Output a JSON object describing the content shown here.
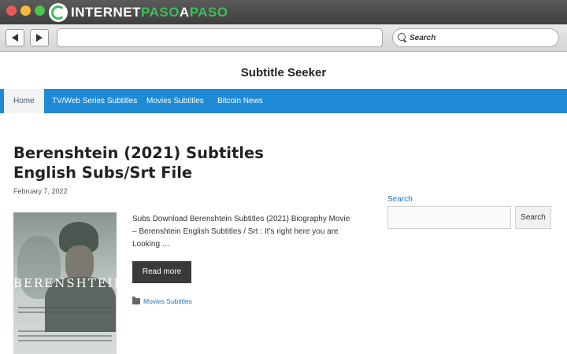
{
  "browser": {
    "brand_part1": "INTERNET",
    "brand_part2": "PASO",
    "brand_part3": "A",
    "brand_part4": "PASO",
    "search_placeholder": "Search"
  },
  "site": {
    "title": "Subtitle Seeker",
    "menu": [
      {
        "label": "Home",
        "active": true
      },
      {
        "label": "TV/Web Series Subtitles"
      },
      {
        "label": "Movies Subtitles"
      },
      {
        "label": "Bitcoin News"
      }
    ]
  },
  "post": {
    "title": "Berenshtein (2021) Subtitles English Subs/Srt File",
    "date": "February 7, 2022",
    "poster_title": "BERENSHTEIN",
    "excerpt": "Subs Download Berenshtein Subtitles (2021) Biography Movie – Berenshtein English Subtitles / Srt : It’s right here you are Looking …",
    "read_more": "Read more",
    "category": "Movies Subtitles"
  },
  "sidebar": {
    "search_title": "Search",
    "search_button": "Search"
  },
  "colors": {
    "menu_bg": "#1e8ad6",
    "link": "#1e73be",
    "brand_green": "#3cbf5a"
  }
}
